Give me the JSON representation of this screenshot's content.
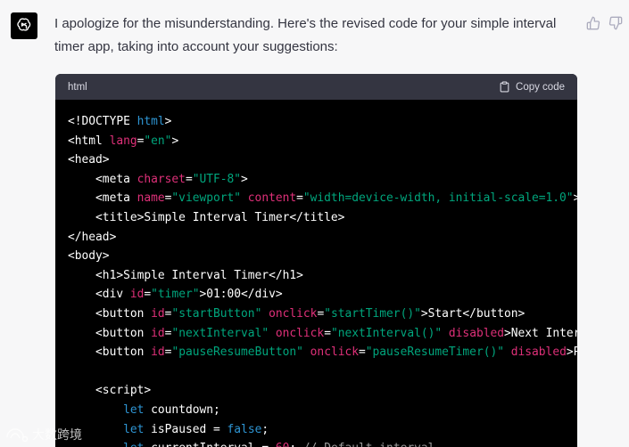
{
  "message": {
    "text": "I apologize for the misunderstanding. Here's the revised code for your simple interval timer app, taking into account your suggestions:"
  },
  "feedback": {
    "thumbs_up_icon": "thumbs-up-icon",
    "thumbs_down_icon": "thumbs-down-icon"
  },
  "code_block": {
    "language": "html",
    "copy_label": "Copy code",
    "lines": [
      [
        {
          "t": "<!DOCTYPE ",
          "c": "tag"
        },
        {
          "t": "html",
          "c": "kw"
        },
        {
          "t": ">",
          "c": "tag"
        }
      ],
      [
        {
          "t": "<html ",
          "c": "tag"
        },
        {
          "t": "lang",
          "c": "attr"
        },
        {
          "t": "=",
          "c": "tag"
        },
        {
          "t": "\"en\"",
          "c": "str"
        },
        {
          "t": ">",
          "c": "tag"
        }
      ],
      [
        {
          "t": "<head>",
          "c": "tag"
        }
      ],
      [
        {
          "t": "    <meta ",
          "c": "tag"
        },
        {
          "t": "charset",
          "c": "attr"
        },
        {
          "t": "=",
          "c": "tag"
        },
        {
          "t": "\"UTF-8\"",
          "c": "str"
        },
        {
          "t": ">",
          "c": "tag"
        }
      ],
      [
        {
          "t": "    <meta ",
          "c": "tag"
        },
        {
          "t": "name",
          "c": "attr"
        },
        {
          "t": "=",
          "c": "tag"
        },
        {
          "t": "\"viewport\"",
          "c": "str"
        },
        {
          "t": " ",
          "c": "tag"
        },
        {
          "t": "content",
          "c": "attr"
        },
        {
          "t": "=",
          "c": "tag"
        },
        {
          "t": "\"width=device-width, initial-scale=1.0\"",
          "c": "str"
        },
        {
          "t": ">",
          "c": "tag"
        }
      ],
      [
        {
          "t": "    <title>Simple Interval Timer</title>",
          "c": "tag"
        }
      ],
      [
        {
          "t": "</head>",
          "c": "tag"
        }
      ],
      [
        {
          "t": "<body>",
          "c": "tag"
        }
      ],
      [
        {
          "t": "    <h1>Simple Interval Timer</h1>",
          "c": "tag"
        }
      ],
      [
        {
          "t": "    <div ",
          "c": "tag"
        },
        {
          "t": "id",
          "c": "attr"
        },
        {
          "t": "=",
          "c": "tag"
        },
        {
          "t": "\"timer\"",
          "c": "str"
        },
        {
          "t": ">01:00</div>",
          "c": "tag"
        }
      ],
      [
        {
          "t": "    <button ",
          "c": "tag"
        },
        {
          "t": "id",
          "c": "attr"
        },
        {
          "t": "=",
          "c": "tag"
        },
        {
          "t": "\"startButton\"",
          "c": "str"
        },
        {
          "t": " ",
          "c": "tag"
        },
        {
          "t": "onclick",
          "c": "attr"
        },
        {
          "t": "=",
          "c": "tag"
        },
        {
          "t": "\"startTimer()\"",
          "c": "str"
        },
        {
          "t": ">Start</button>",
          "c": "tag"
        }
      ],
      [
        {
          "t": "    <button ",
          "c": "tag"
        },
        {
          "t": "id",
          "c": "attr"
        },
        {
          "t": "=",
          "c": "tag"
        },
        {
          "t": "\"nextInterval\"",
          "c": "str"
        },
        {
          "t": " ",
          "c": "tag"
        },
        {
          "t": "onclick",
          "c": "attr"
        },
        {
          "t": "=",
          "c": "tag"
        },
        {
          "t": "\"nextInterval()\"",
          "c": "str"
        },
        {
          "t": " ",
          "c": "tag"
        },
        {
          "t": "disabled",
          "c": "attr"
        },
        {
          "t": ">Next Interval</button>",
          "c": "tag"
        }
      ],
      [
        {
          "t": "    <button ",
          "c": "tag"
        },
        {
          "t": "id",
          "c": "attr"
        },
        {
          "t": "=",
          "c": "tag"
        },
        {
          "t": "\"pauseResumeButton\"",
          "c": "str"
        },
        {
          "t": " ",
          "c": "tag"
        },
        {
          "t": "onclick",
          "c": "attr"
        },
        {
          "t": "=",
          "c": "tag"
        },
        {
          "t": "\"pauseResumeTimer()\"",
          "c": "str"
        },
        {
          "t": " ",
          "c": "tag"
        },
        {
          "t": "disabled",
          "c": "attr"
        },
        {
          "t": ">Pause</button>",
          "c": "tag"
        }
      ],
      [
        {
          "t": "",
          "c": "tag"
        }
      ],
      [
        {
          "t": "    <script>",
          "c": "tag"
        }
      ],
      [
        {
          "t": "        ",
          "c": "tag"
        },
        {
          "t": "let",
          "c": "kw"
        },
        {
          "t": " countdown;",
          "c": "tag"
        }
      ],
      [
        {
          "t": "        ",
          "c": "tag"
        },
        {
          "t": "let",
          "c": "kw"
        },
        {
          "t": " isPaused = ",
          "c": "tag"
        },
        {
          "t": "false",
          "c": "kw"
        },
        {
          "t": ";",
          "c": "tag"
        }
      ],
      [
        {
          "t": "        ",
          "c": "tag"
        },
        {
          "t": "let",
          "c": "kw"
        },
        {
          "t": " currentInterval = ",
          "c": "tag"
        },
        {
          "t": "60",
          "c": "attr"
        },
        {
          "t": "; ",
          "c": "tag"
        },
        {
          "t": "// Default interval",
          "c": "comment"
        }
      ]
    ]
  },
  "watermark": {
    "text": "大数跨境"
  },
  "colors": {
    "background": "#f7f7f8",
    "code_bg": "#000000",
    "code_header_bg": "#343541",
    "keyword": "#2e95d3",
    "attribute": "#df3079",
    "string": "#00a67d"
  }
}
